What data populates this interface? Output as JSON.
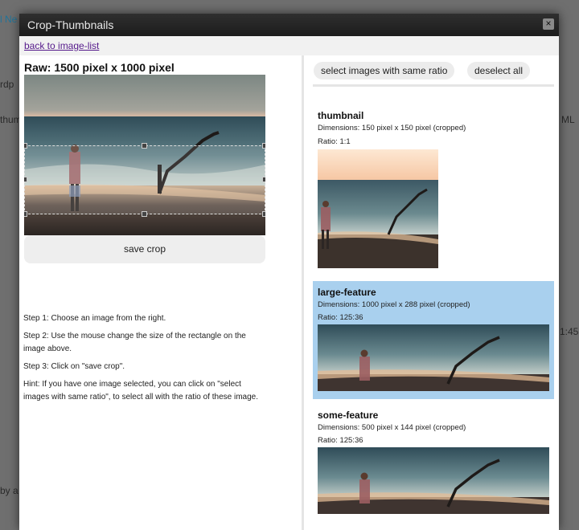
{
  "background": {
    "fragments": [
      "l Ne",
      "rdp",
      "thum",
      "ML",
      "1:45",
      "by a"
    ]
  },
  "modal": {
    "title": "Crop-Thumbnails",
    "close_icon": "close-icon",
    "back_link": "back to image-list"
  },
  "left": {
    "raw_label": "Raw: 1500 pixel x 1000 pixel",
    "save_button": "save crop",
    "steps": [
      "Step 1: Choose an image from the right.",
      "Step 2: Use the mouse change the size of the rectangle on the image above.",
      "Step 3: Click on \"save crop\".",
      "Hint: If you have one image selected, you can click on \"select images with same ratio\", to select all with the ratio of these image."
    ]
  },
  "right": {
    "select_same_ratio": "select images with same ratio",
    "deselect_all": "deselect all",
    "items": [
      {
        "name": "thumbnail",
        "dimensions": "Dimensions: 150 pixel x 150 pixel (cropped)",
        "ratio": "Ratio: 1:1",
        "selected": false
      },
      {
        "name": "large-feature",
        "dimensions": "Dimensions: 1000 pixel x 288 pixel (cropped)",
        "ratio": "Ratio: 125:36",
        "selected": true
      },
      {
        "name": "some-feature",
        "dimensions": "Dimensions: 500 pixel x 144 pixel (cropped)",
        "ratio": "Ratio: 125:36",
        "selected": false
      }
    ]
  },
  "colors": {
    "selected_item": "#a9d0ee",
    "titlebar": "#222222",
    "link_visited": "#551a8b"
  }
}
